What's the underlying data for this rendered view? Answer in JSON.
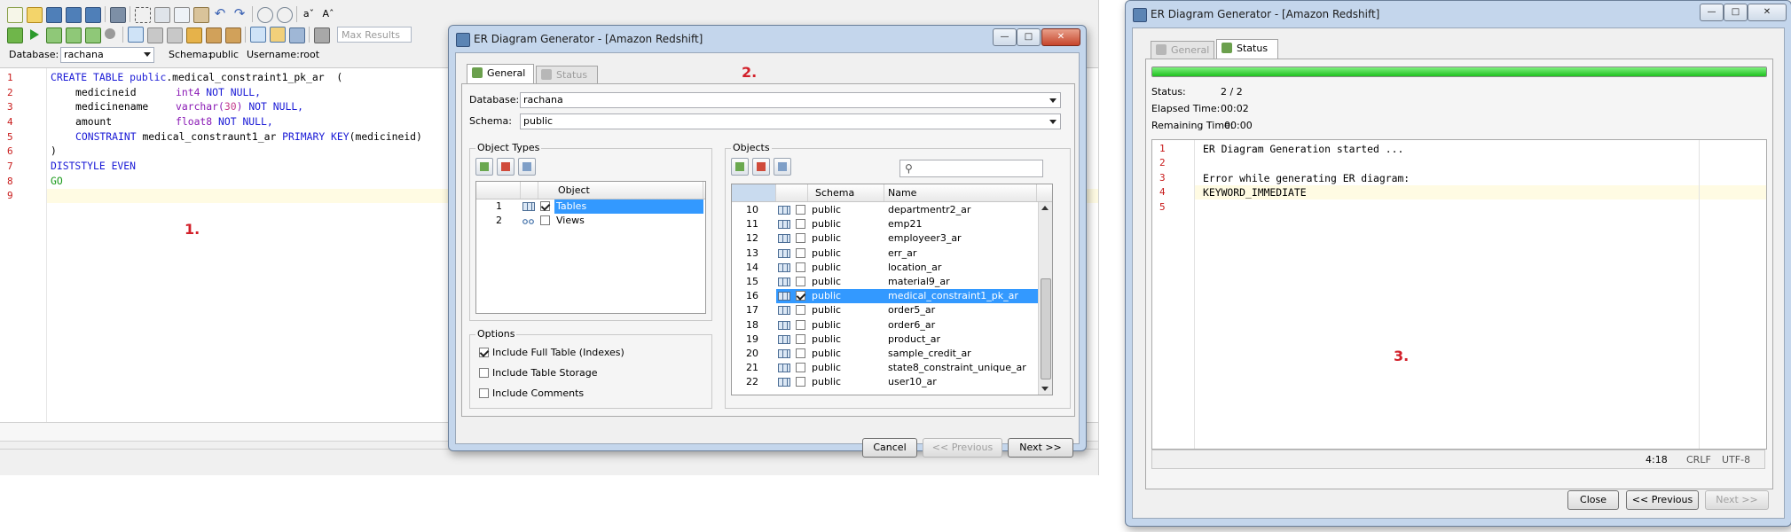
{
  "editor": {
    "toolbar": {
      "max_results_placeholder": "Max Results"
    },
    "database_label": "Database:",
    "database_value": "rachana",
    "schema_label": "Schema:",
    "schema_value": "public",
    "username_label": "Username:",
    "username_value": "root",
    "line_numbers": [
      "1",
      "2",
      "3",
      "4",
      "5",
      "6",
      "7",
      "8",
      "9"
    ],
    "code": {
      "l1_kw": "CREATE TABLE",
      "l1_a": "public",
      "l1_b": ".medical_constraint1_pk_ar  (",
      "l2_name": "medicineid",
      "l2_type": "int4",
      "l2_mod": "NOT NULL,",
      "l3_name": "medicinename",
      "l3_type": "varchar(",
      "l3_num": "30",
      "l3_close": ")",
      "l3_mod": "NOT NULL,",
      "l4_name": "amount",
      "l4_type": "float8",
      "l4_mod": "NOT NULL,",
      "l5_kw": "CONSTRAINT",
      "l5_name": "medical_constraunt1_ar",
      "l5_kw2": "PRIMARY KEY",
      "l5_rest": "(medicineid)",
      "l6": ")",
      "l7": "DISTSTYLE EVEN",
      "l8": "GO"
    },
    "annotation": "1."
  },
  "dialog": {
    "title": "ER Diagram Generator - [Amazon Redshift]",
    "annotation": "2.",
    "tabs": {
      "general": "General",
      "status": "Status"
    },
    "database_label": "Database:",
    "database_value": "rachana",
    "schema_label": "Schema:",
    "schema_value": "public",
    "object_types": {
      "title": "Object Types",
      "col_object": "Object",
      "rows": [
        {
          "num": "1",
          "label": "Tables",
          "checked": true
        },
        {
          "num": "2",
          "label": "Views",
          "checked": false
        }
      ]
    },
    "objects": {
      "title": "Objects",
      "col_schema": "Schema",
      "col_name": "Name",
      "rows": [
        {
          "num": "10",
          "schema": "public",
          "name": "departmentr2_ar",
          "checked": false
        },
        {
          "num": "11",
          "schema": "public",
          "name": "emp21",
          "checked": false
        },
        {
          "num": "12",
          "schema": "public",
          "name": "employeer3_ar",
          "checked": false
        },
        {
          "num": "13",
          "schema": "public",
          "name": "err_ar",
          "checked": false
        },
        {
          "num": "14",
          "schema": "public",
          "name": "location_ar",
          "checked": false
        },
        {
          "num": "15",
          "schema": "public",
          "name": "material9_ar",
          "checked": false
        },
        {
          "num": "16",
          "schema": "public",
          "name": "medical_constraint1_pk_ar",
          "checked": true
        },
        {
          "num": "17",
          "schema": "public",
          "name": "order5_ar",
          "checked": false
        },
        {
          "num": "18",
          "schema": "public",
          "name": "order6_ar",
          "checked": false
        },
        {
          "num": "19",
          "schema": "public",
          "name": "product_ar",
          "checked": false
        },
        {
          "num": "20",
          "schema": "public",
          "name": "sample_credit_ar",
          "checked": false
        },
        {
          "num": "21",
          "schema": "public",
          "name": "state8_constraint_unique_ar",
          "checked": false
        },
        {
          "num": "22",
          "schema": "public",
          "name": "user10_ar",
          "checked": false
        }
      ]
    },
    "options": {
      "title": "Options",
      "full_table": "Include Full Table (Indexes)",
      "table_storage": "Include Table Storage",
      "comments": "Include Comments"
    },
    "buttons": {
      "cancel": "Cancel",
      "previous": "<< Previous",
      "next": "Next >>"
    }
  },
  "status_dialog": {
    "title": "ER Diagram Generator - [Amazon Redshift]",
    "annotation": "3.",
    "tabs": {
      "general": "General",
      "status": "Status"
    },
    "progress": 1.0,
    "status_label": "Status:",
    "status_value": "2 / 2",
    "elapsed_label": "Elapsed Time:",
    "elapsed_value": "00:02",
    "remaining_label": "Remaining Time:",
    "remaining_value": "00:00",
    "log_line_numbers": [
      "1",
      "2",
      "3",
      "4",
      "5"
    ],
    "log": {
      "l1": "ER Diagram Generation started ...",
      "l2": "",
      "l3": "Error while generating ER diagram:",
      "l4": "KEYWORD_IMMEDIATE",
      "l5": ""
    },
    "statusbar": {
      "pos": "4:18",
      "eol": "CRLF",
      "enc": "UTF-8"
    },
    "buttons": {
      "close": "Close",
      "previous": "<< Previous",
      "next": "Next >>"
    }
  },
  "colors": {
    "accent_blue": "#3399ff",
    "keyword": "#1a1ad6",
    "type": "#8a1ab5",
    "progress_green": "#1fc11f",
    "annotation_red": "#d2202a"
  }
}
